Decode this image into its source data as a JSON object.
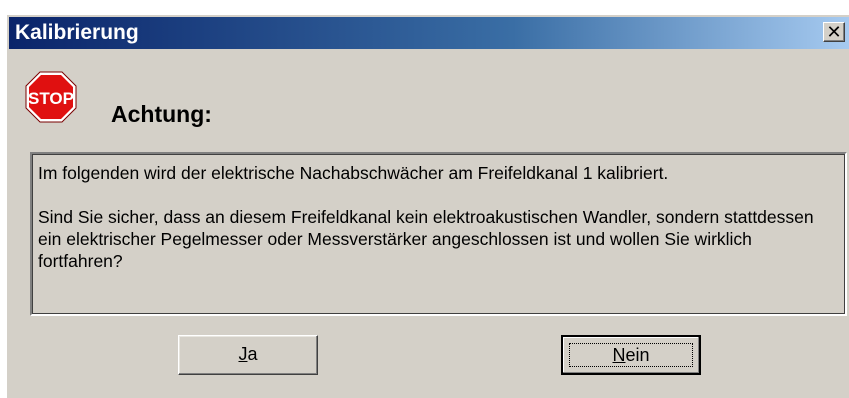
{
  "window": {
    "title": "Kalibrierung",
    "close_glyph": "✕"
  },
  "icon": {
    "name": "stop-icon",
    "text": "STOP",
    "color": "#e01010"
  },
  "heading": "Achtung:",
  "message": {
    "line1": "Im folgenden wird der elektrische Nachabschwächer am Freifeldkanal 1 kalibriert.",
    "line2": "Sind Sie sicher, dass an diesem Freifeldkanal kein elektroakustischen Wandler, sondern stattdessen ein elektrischer Pegelmesser oder Messverstärker angeschlossen ist und wollen Sie wirklich fortfahren?"
  },
  "buttons": {
    "yes": {
      "accel": "J",
      "rest": "a"
    },
    "no": {
      "accel": "N",
      "rest": "ein"
    }
  }
}
